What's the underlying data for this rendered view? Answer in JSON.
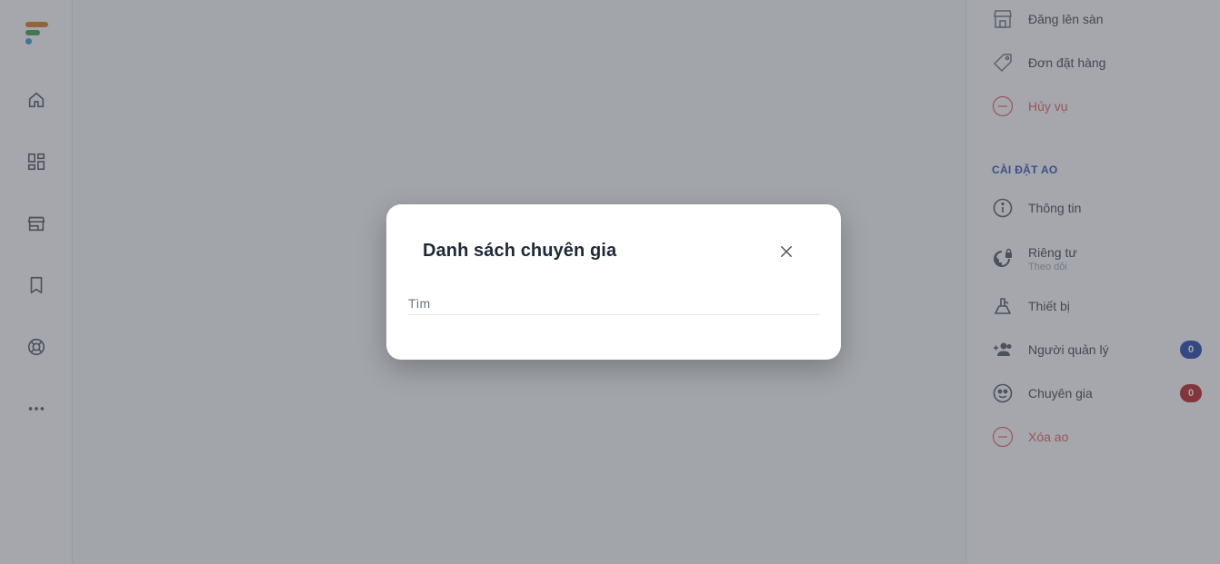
{
  "left_nav": {
    "icons": [
      "home-icon",
      "dashboard-icon",
      "store-icon",
      "bookmark-icon",
      "support-icon",
      "more-icon"
    ]
  },
  "right_panel": {
    "items_top": [
      {
        "label": "Đăng lên sàn",
        "icon": "store-icon"
      },
      {
        "label": "Đơn đặt hàng",
        "icon": "tag-icon"
      },
      {
        "label": "Hủy vụ",
        "icon": "remove-circle-icon",
        "danger": true
      }
    ],
    "section_title": "CÀI ĐẶT AO",
    "items_settings": [
      {
        "label": "Thông tin",
        "icon": "info-icon"
      },
      {
        "label": "Riêng tư",
        "sublabel": "Theo dõi",
        "icon": "globe-lock-icon"
      },
      {
        "label": "Thiết bị",
        "icon": "device-icon"
      },
      {
        "label": "Người quản lý",
        "icon": "group-add-icon",
        "badge": "0",
        "badge_color": "#1e40af"
      },
      {
        "label": "Chuyên gia",
        "icon": "expert-icon",
        "badge": "0",
        "badge_color": "#b91c1c"
      },
      {
        "label": "Xóa ao",
        "icon": "remove-circle-icon",
        "danger": true
      }
    ]
  },
  "modal": {
    "title": "Danh sách chuyên gia",
    "search_placeholder": "Tìm"
  },
  "colors": {
    "danger": "#e35d5d",
    "accent": "#2d4fb8",
    "overlay": "rgba(75,80,90,0.5)"
  }
}
